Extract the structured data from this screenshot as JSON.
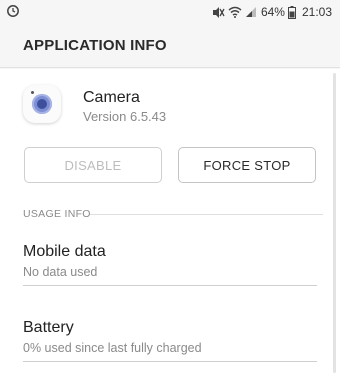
{
  "status_bar": {
    "battery_percent": "64%",
    "time": "21:03",
    "icons": [
      "sync-icon",
      "mute-icon",
      "wifi-icon",
      "signal-icon",
      "battery-icon"
    ]
  },
  "header": {
    "title": "APPLICATION INFO"
  },
  "app": {
    "name": "Camera",
    "version": "Version 6.5.43",
    "icon": "camera-app-icon"
  },
  "buttons": {
    "disable_label": "DISABLE",
    "force_stop_label": "FORCE STOP"
  },
  "usage": {
    "section_label": "USAGE INFO",
    "rows": [
      {
        "title": "Mobile data",
        "subtitle": "No data used"
      },
      {
        "title": "Battery",
        "subtitle": "0% used since last fully charged"
      }
    ]
  },
  "colors": {
    "background": "#f6f6f6",
    "card": "#ffffff",
    "secondary_text": "#8a8a8a",
    "disabled_text": "#bdbdbd",
    "camera_lens": "#7d8fd2"
  }
}
